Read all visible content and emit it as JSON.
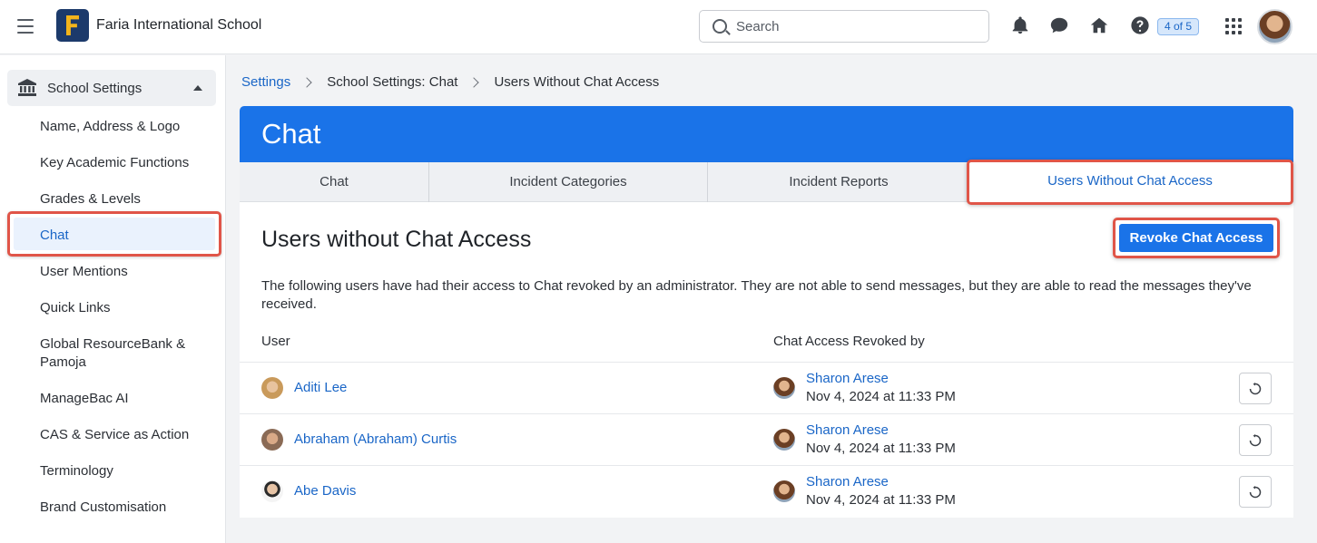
{
  "app": {
    "school_name": "Faria International School",
    "search_placeholder": "Search",
    "help_badge": "4 of 5"
  },
  "icons": {
    "menu": "hamburger-icon",
    "bell": "bell-icon",
    "chat": "chat-bubble-icon",
    "home": "home-icon",
    "help": "question-icon",
    "apps": "apps-grid-icon",
    "bank": "bank-icon",
    "restore": "restore-icon"
  },
  "sidebar": {
    "header": "School Settings",
    "items": [
      {
        "label": "Name, Address & Logo"
      },
      {
        "label": "Key Academic Functions"
      },
      {
        "label": "Grades & Levels"
      },
      {
        "label": "Chat"
      },
      {
        "label": "User Mentions"
      },
      {
        "label": "Quick Links"
      },
      {
        "label": "Global ResourceBank & Pamoja"
      },
      {
        "label": "ManageBac AI"
      },
      {
        "label": "CAS & Service as Action"
      },
      {
        "label": "Terminology"
      },
      {
        "label": "Brand Customisation"
      }
    ]
  },
  "breadcrumb": {
    "root": "Settings",
    "middle": "School Settings: Chat",
    "current": "Users Without Chat Access"
  },
  "card": {
    "title": "Chat",
    "tabs": [
      {
        "label": "Chat"
      },
      {
        "label": "Incident Categories"
      },
      {
        "label": "Incident Reports"
      },
      {
        "label": "Users Without Chat Access"
      }
    ],
    "section_title": "Users without Chat Access",
    "revoke_button": "Revoke Chat Access",
    "description": "The following users have had their access to Chat revoked by an administrator. They are not able to send messages, but they are able to read the messages they've received.",
    "columns": {
      "user": "User",
      "revoked_by": "Chat Access Revoked by"
    },
    "rows": [
      {
        "user": "Aditi Lee",
        "revoked_by": "Sharon Arese",
        "date": "Nov 4, 2024 at 11:33 PM"
      },
      {
        "user": "Abraham (Abraham) Curtis",
        "revoked_by": "Sharon Arese",
        "date": "Nov 4, 2024 at 11:33 PM"
      },
      {
        "user": "Abe Davis",
        "revoked_by": "Sharon Arese",
        "date": "Nov 4, 2024 at 11:33 PM"
      }
    ]
  },
  "colors": {
    "accent": "#1a73e8",
    "link": "#1a66c7",
    "highlight": "#e05548"
  }
}
